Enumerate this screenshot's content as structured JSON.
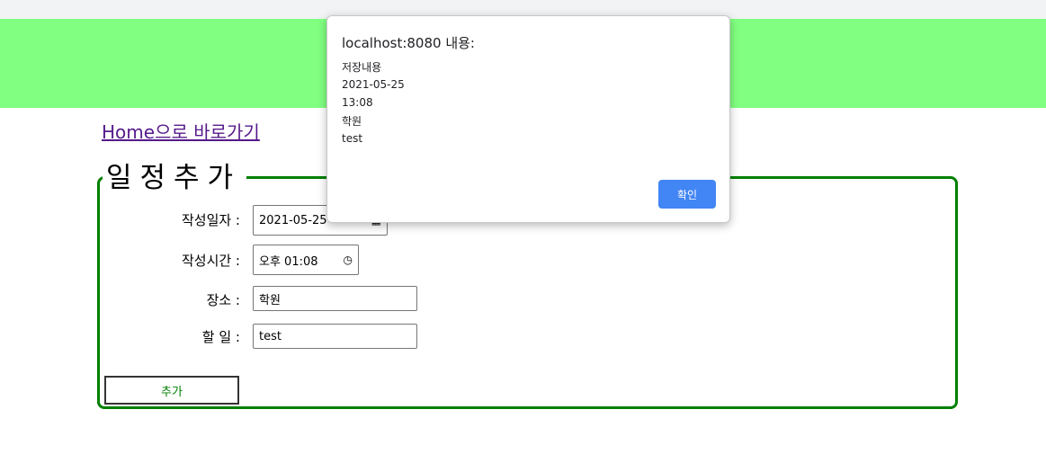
{
  "home_link": "Home으로 바로가기",
  "form": {
    "legend": "일정추가",
    "date_label": "작성일자 :",
    "date_value": "2021-05-25",
    "time_label": "작성시간 :",
    "time_value": "오후 01:08",
    "place_label": "장소 :",
    "place_value": "학원",
    "todo_label": "할 일 :",
    "todo_value": "test",
    "submit_label": "추가"
  },
  "dialog": {
    "title": "localhost:8080 내용:",
    "lines": [
      "저장내용",
      "2021-05-25",
      "13:08",
      "학원",
      "test"
    ],
    "ok_label": "확인"
  },
  "icons": {
    "calendar": "calendar-icon",
    "clock": "clock-icon"
  },
  "colors": {
    "banner": "#80ff80",
    "fieldset_border": "#008000",
    "link": "#551a8b",
    "ok_button": "#4285f4"
  }
}
